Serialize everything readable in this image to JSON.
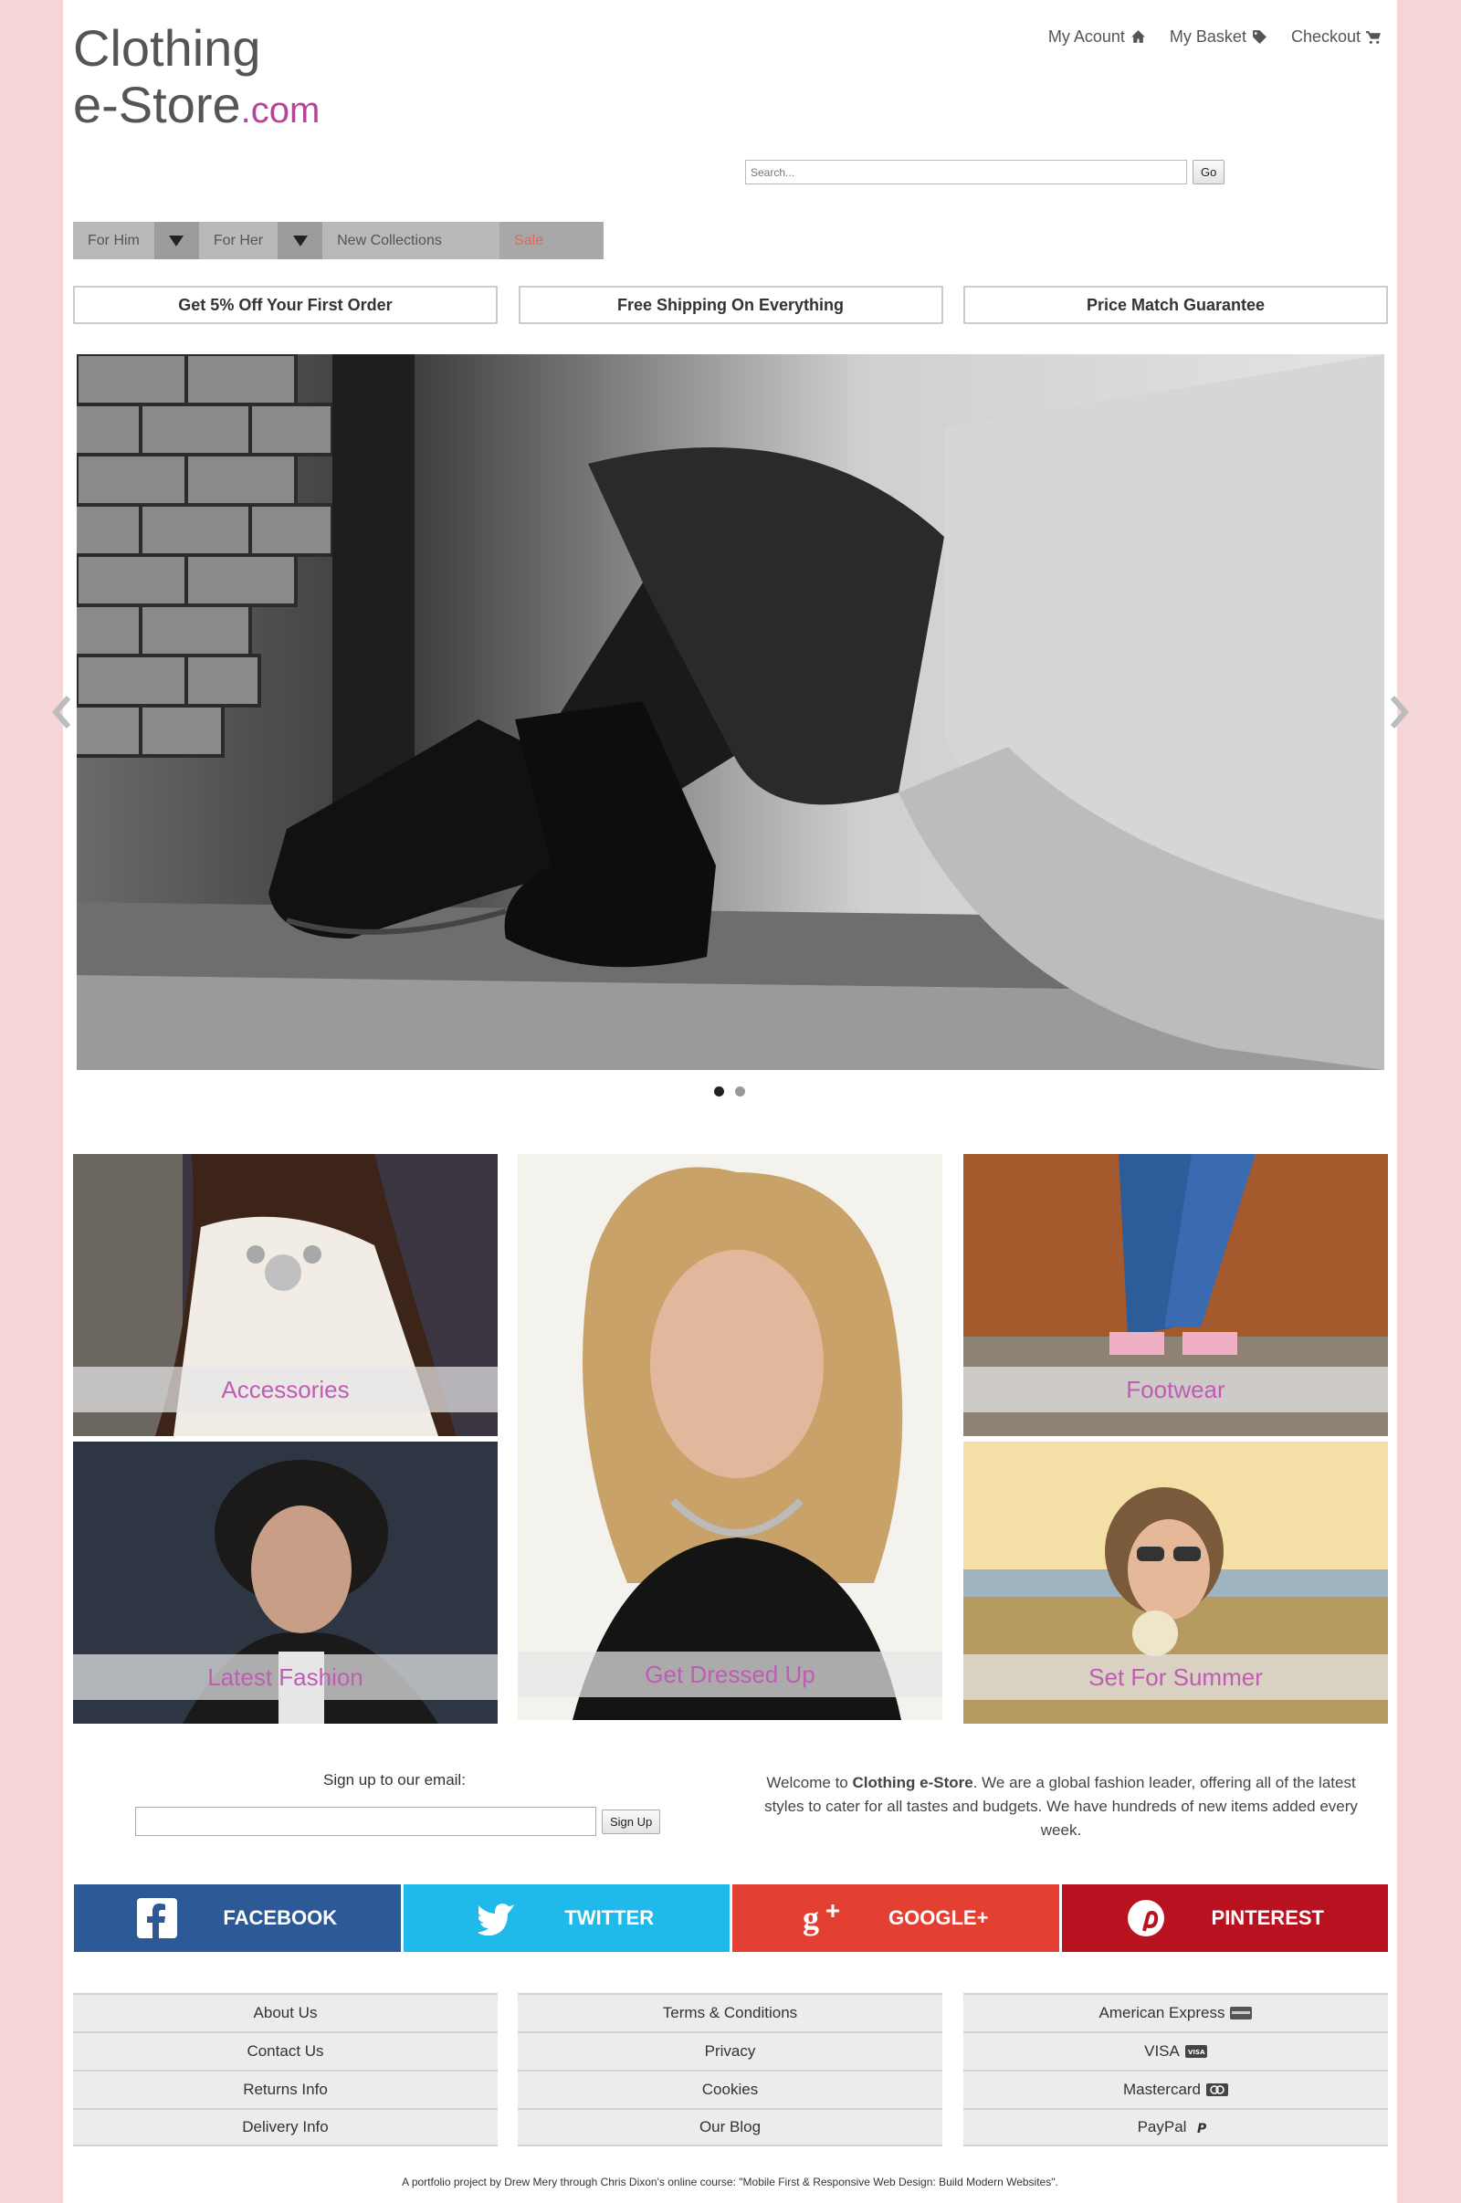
{
  "header": {
    "logo_line1": "Clothing",
    "logo_line2": "e-Store",
    "logo_suffix": ".com",
    "nav": [
      {
        "label": "My Acount",
        "icon": "home-icon"
      },
      {
        "label": "My Basket",
        "icon": "tag-icon"
      },
      {
        "label": "Checkout",
        "icon": "cart-icon"
      }
    ],
    "search_placeholder": "Search...",
    "search_button": "Go"
  },
  "main_nav": {
    "for_him": "For Him",
    "for_her": "For Her",
    "new_collections": "New Collections",
    "sale": "Sale"
  },
  "promos": [
    "Get 5% Off Your First Order",
    "Free Shipping On Everything",
    "Price Match Guarantee"
  ],
  "carousel": {
    "slide_count": 2,
    "active_index": 0
  },
  "categories": {
    "accessories": "Accessories",
    "latest_fashion": "Latest Fashion",
    "get_dressed_up": "Get Dressed Up",
    "footwear": "Footwear",
    "set_for_summer": "Set For Summer"
  },
  "signup": {
    "label": "Sign up to our email:",
    "button": "Sign Up"
  },
  "welcome": {
    "prefix": "Welcome to ",
    "brand": "Clothing e-Store",
    "text": ". We are a global fashion leader, offering all of the latest styles to cater for all tastes and budgets. We have hundreds of new items added every week."
  },
  "social": {
    "facebook": "FACEBOOK",
    "twitter": "TWITTER",
    "google": "GOOGLE+",
    "pinterest": "PINTEREST",
    "colors": {
      "facebook": "#2d5a96",
      "twitter": "#1fb9ea",
      "google": "#e34033",
      "pinterest": "#b8111f"
    }
  },
  "footer": {
    "col1": [
      "About Us",
      "Contact Us",
      "Returns Info",
      "Delivery Info"
    ],
    "col2": [
      "Terms & Conditions",
      "Privacy",
      "Cookies",
      "Our Blog"
    ],
    "col3": [
      "American Express",
      "VISA",
      "Mastercard",
      "PayPal"
    ],
    "credit": "A portfolio project by Drew Mery through Chris Dixon's online course: \"Mobile First & Responsive Web Design: Build Modern Websites\"."
  },
  "colors": {
    "page_bg": "#f5d6d6",
    "accent": "#b5449a",
    "sale": "#e8635a"
  }
}
